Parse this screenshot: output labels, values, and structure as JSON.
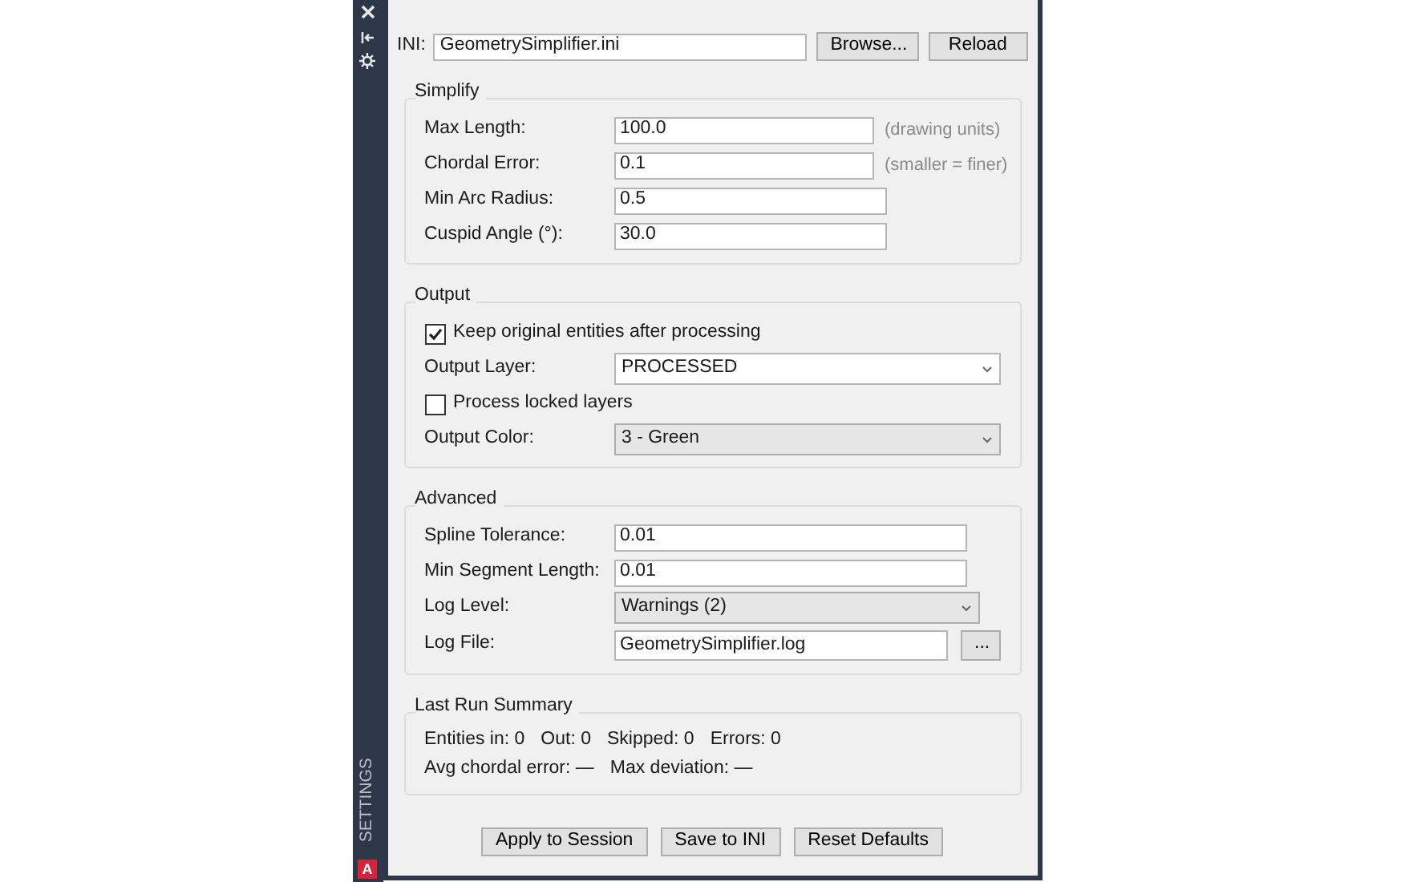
{
  "sidebar": {
    "title": "SETTINGS",
    "badge": "A"
  },
  "ini": {
    "label": "INI:",
    "value": "GeometrySimplifier.ini",
    "buttons": [
      "Browse...",
      "Reload"
    ]
  },
  "groups": [
    {
      "title": "Simplify",
      "rows": [
        {
          "kind": "text",
          "label": "Max Length:",
          "value": "100.0",
          "hint": "(drawing units)"
        },
        {
          "kind": "text",
          "label": "Chordal Error:",
          "value": "0.1",
          "hint": "(smaller = finer)"
        },
        {
          "kind": "text",
          "label": "Min Arc Radius:",
          "value": "0.5"
        },
        {
          "kind": "text",
          "label": "Cuspid Angle (°):",
          "value": "30.0"
        }
      ]
    },
    {
      "title": "Output",
      "rows": [
        {
          "kind": "checkbox",
          "label": "Keep original entities after processing",
          "checked": true
        },
        {
          "kind": "select",
          "label": "Output Layer:",
          "value": "PROCESSED",
          "editable": true
        },
        {
          "kind": "checkbox",
          "label": "Process locked layers",
          "checked": false
        },
        {
          "kind": "select",
          "label": "Output Color:",
          "value": "3 - Green",
          "editable": false
        }
      ]
    },
    {
      "title": "Advanced",
      "rows": [
        {
          "kind": "shorttext",
          "label": "Spline Tolerance:",
          "value": "0.01"
        },
        {
          "kind": "shorttext",
          "label": "Min Segment Length:",
          "value": "0.01"
        },
        {
          "kind": "shortselect",
          "label": "Log Level:",
          "value": "Warnings (2)"
        },
        {
          "kind": "file",
          "label": "Log File:",
          "value": "GeometrySimplifier.log",
          "button": "..."
        }
      ]
    }
  ],
  "summary": {
    "title": "Last Run Summary",
    "lines": [
      [
        "Entities in: 0",
        "Out: 0",
        "Skipped: 0",
        "Errors: 0"
      ],
      [
        "Avg chordal error: —",
        "Max deviation: —"
      ]
    ]
  },
  "actions": [
    "Apply to Session",
    "Save to INI",
    "Reset Defaults"
  ]
}
